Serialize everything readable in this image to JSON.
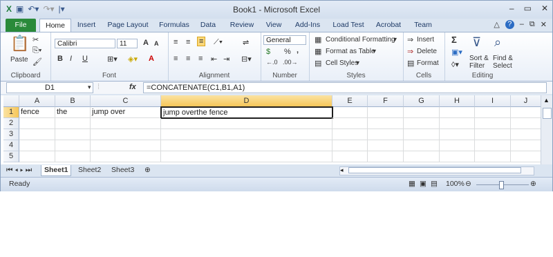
{
  "titlebar": {
    "title": "Book1 - Microsoft Excel"
  },
  "tabs": [
    "File",
    "Home",
    "Insert",
    "Page Layout",
    "Formulas",
    "Data",
    "Review",
    "View",
    "Add-Ins",
    "Load Test",
    "Acrobat",
    "Team"
  ],
  "ribbon": {
    "clipboard": {
      "paste": "Paste",
      "label": "Clipboard"
    },
    "font": {
      "name": "Calibri",
      "size": "11",
      "bold": "B",
      "italic": "I",
      "underline": "U",
      "grow": "A",
      "shrink": "A",
      "color": "A",
      "label": "Font"
    },
    "alignment": {
      "label": "Alignment"
    },
    "number": {
      "format": "General",
      "currency": "$",
      "percent": "%",
      "comma": ",",
      "label": "Number"
    },
    "styles": {
      "conditional": "Conditional Formatting",
      "table": "Format as Table",
      "cell": "Cell Styles",
      "label": "Styles"
    },
    "cells": {
      "insert": "Insert",
      "delete": "Delete",
      "format": "Format",
      "label": "Cells"
    },
    "editing": {
      "sigma": "Σ",
      "sort1": "Sort &",
      "sort2": "Filter",
      "find1": "Find &",
      "find2": "Select",
      "label": "Editing"
    }
  },
  "formula": {
    "namebox": "D1",
    "fx": "fx",
    "value": "=CONCATENATE(C1,B1,A1)"
  },
  "columns": [
    "A",
    "B",
    "C",
    "D",
    "E",
    "F",
    "G",
    "H",
    "I",
    "J"
  ],
  "rows": [
    "1",
    "2",
    "3",
    "4",
    "5"
  ],
  "cells": {
    "A1": "fence",
    "B1": "the",
    "C1": "jump over",
    "D1": "jump overthe fence"
  },
  "sheets": [
    "Sheet1",
    "Sheet2",
    "Sheet3"
  ],
  "status": {
    "ready": "Ready",
    "zoom": "100%"
  }
}
